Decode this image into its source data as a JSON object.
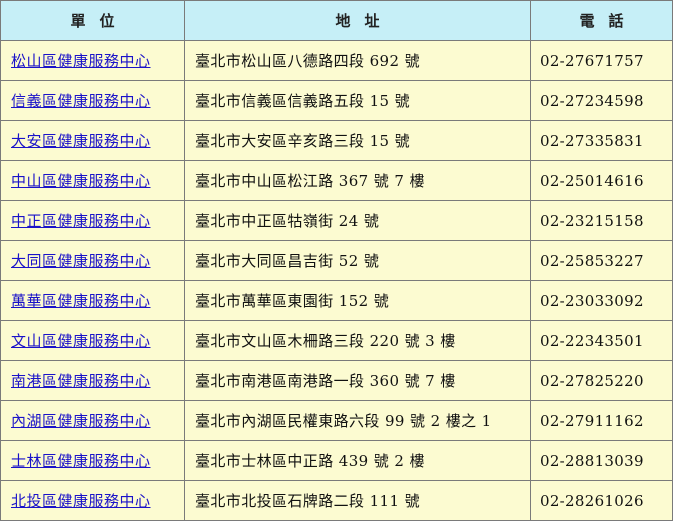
{
  "header": {
    "unit": "單位",
    "address": "地址",
    "phone": "電話"
  },
  "rows": [
    {
      "unit": "松山區健康服務中心",
      "address": "臺北市松山區八德路四段 692 號",
      "phone": "02-27671757"
    },
    {
      "unit": "信義區健康服務中心",
      "address": "臺北市信義區信義路五段 15 號",
      "phone": "02-27234598"
    },
    {
      "unit": "大安區健康服務中心",
      "address": "臺北市大安區辛亥路三段 15 號",
      "phone": "02-27335831"
    },
    {
      "unit": "中山區健康服務中心",
      "address": "臺北市中山區松江路 367 號 7 樓",
      "phone": "02-25014616"
    },
    {
      "unit": "中正區健康服務中心",
      "address": "臺北市中正區牯嶺街 24 號",
      "phone": "02-23215158"
    },
    {
      "unit": "大同區健康服務中心",
      "address": "臺北市大同區昌吉街 52 號",
      "phone": "02-25853227"
    },
    {
      "unit": "萬華區健康服務中心",
      "address": "臺北市萬華區東園街 152 號",
      "phone": "02-23033092"
    },
    {
      "unit": "文山區健康服務中心",
      "address": "臺北市文山區木柵路三段 220 號 3 樓",
      "phone": "02-22343501"
    },
    {
      "unit": "南港區健康服務中心",
      "address": "臺北市南港區南港路一段 360 號 7 樓",
      "phone": "02-27825220"
    },
    {
      "unit": "內湖區健康服務中心",
      "address": "臺北市內湖區民權東路六段 99 號 2 樓之 1",
      "phone": "02-27911162"
    },
    {
      "unit": "士林區健康服務中心",
      "address": "臺北市士林區中正路 439 號 2 樓",
      "phone": "02-28813039"
    },
    {
      "unit": "北投區健康服務中心",
      "address": "臺北市北投區石牌路二段 111 號",
      "phone": "02-28261026"
    }
  ],
  "colors": {
    "header_bg": "#c6eff7",
    "row_bg": "#fcfbd1",
    "link": "#1a12c9",
    "border": "#7a7a7a"
  }
}
